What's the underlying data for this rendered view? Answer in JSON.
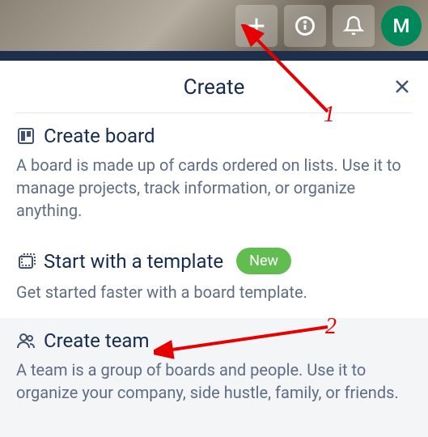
{
  "topbar": {
    "add_button_name": "add-button",
    "info_button_name": "info-button",
    "notifications_button_name": "notifications-button",
    "avatar_initial": "M"
  },
  "panel": {
    "title": "Create",
    "close_name": "close-button",
    "options": [
      {
        "title": "Create board",
        "desc": "A board is made up of cards ordered on lists. Use it to manage projects, track information, or organize anything.",
        "icon": "board-icon",
        "badge": null
      },
      {
        "title": "Start with a template",
        "desc": "Get started faster with a board template.",
        "icon": "template-icon",
        "badge": "New"
      },
      {
        "title": "Create team",
        "desc": "A team is a group of boards and people. Use it to organize your company, side hustle, family, or friends.",
        "icon": "team-icon",
        "badge": null
      }
    ]
  },
  "annotations": {
    "arrow1_label": "1",
    "arrow2_label": "2"
  },
  "colors": {
    "accent_green": "#61bd4f",
    "avatar_green": "#00875a",
    "annotation_red": "#e60000"
  }
}
